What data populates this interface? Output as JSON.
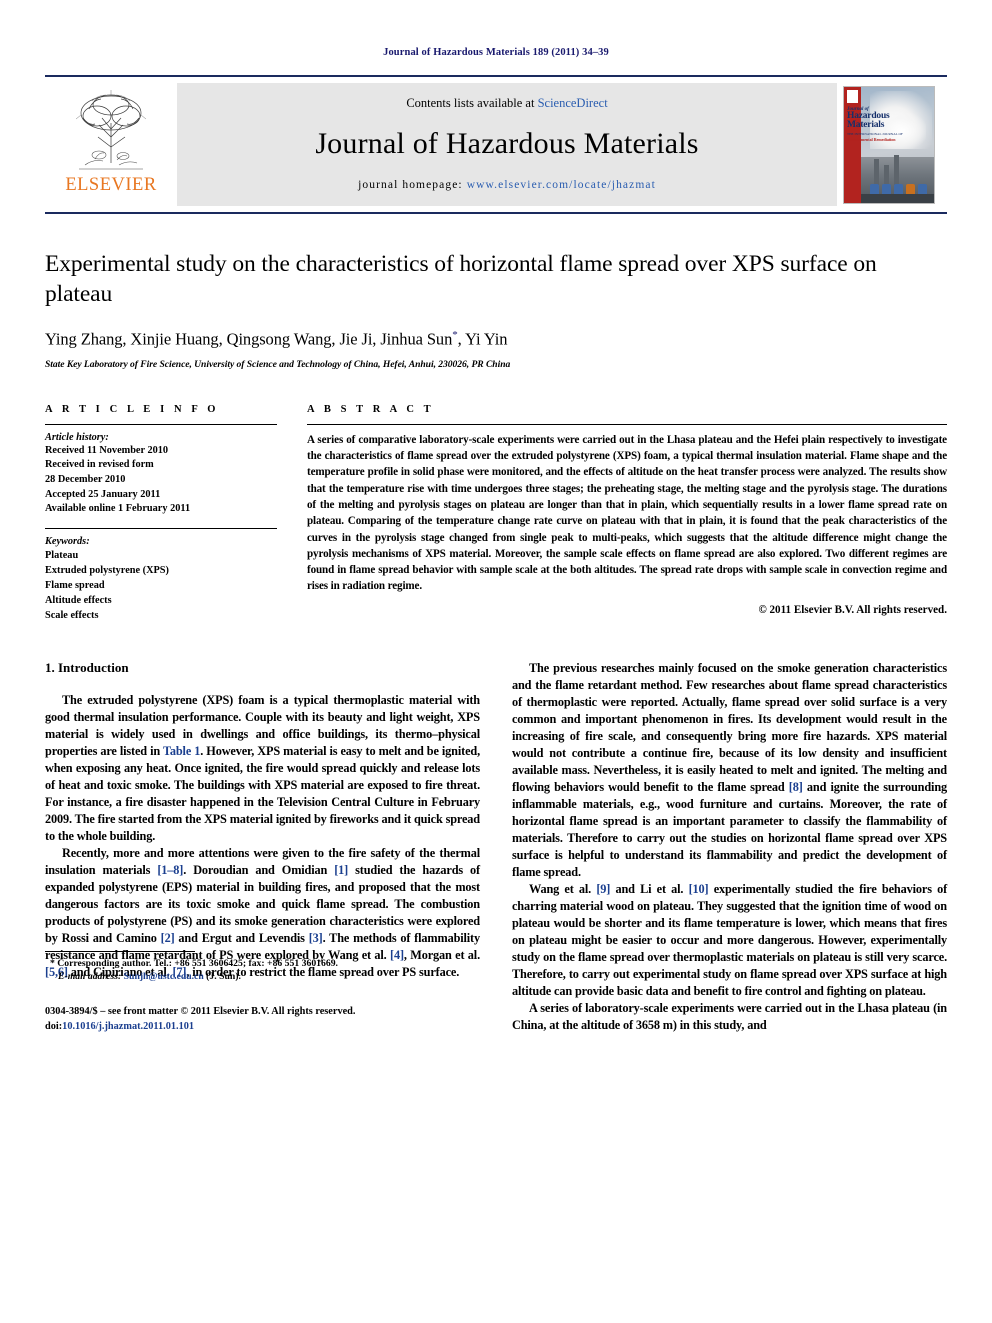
{
  "running_head": "Journal of Hazardous Materials 189 (2011) 34–39",
  "masthead": {
    "publisher": "ELSEVIER",
    "contents_prefix": "Contents lists available at ",
    "contents_link": "ScienceDirect",
    "journal_title": "Journal of Hazardous Materials",
    "homepage_prefix": "journal homepage:",
    "homepage_url": "www.elsevier.com/locate/jhazmat",
    "cover": {
      "line1": "Journal of",
      "line2": "Hazardous",
      "line3": "Materials",
      "line4": "THE INTERNATIONAL JOURNAL OF",
      "line5": "Environmental Remediation"
    }
  },
  "article": {
    "title": "Experimental study on the characteristics of horizontal flame spread over XPS surface on plateau",
    "authors": "Ying Zhang, Xinjie Huang, Qingsong Wang, Jie Ji, Jinhua Sun",
    "authors_suffix": ", Yi Yin",
    "corresponding_marker": "*",
    "affiliation": "State Key Laboratory of Fire Science, University of Science and Technology of China, Hefei, Anhui, 230026, PR China"
  },
  "article_info": {
    "heading": "A R T I C L E   I N F O",
    "history_label": "Article history:",
    "history": [
      "Received 11 November 2010",
      "Received in revised form",
      "28 December 2010",
      "Accepted 25 January 2011",
      "Available online 1 February 2011"
    ],
    "keywords_label": "Keywords:",
    "keywords": [
      "Plateau",
      "Extruded polystyrene (XPS)",
      "Flame spread",
      "Altitude effects",
      "Scale effects"
    ]
  },
  "abstract": {
    "heading": "A B S T R A C T",
    "text": "A series of comparative laboratory-scale experiments were carried out in the Lhasa plateau and the Hefei plain respectively to investigate the characteristics of flame spread over the extruded polystyrene (XPS) foam, a typical thermal insulation material. Flame shape and the temperature profile in solid phase were monitored, and the effects of altitude on the heat transfer process were analyzed. The results show that the temperature rise with time undergoes three stages; the preheating stage, the melting stage and the pyrolysis stage. The durations of the melting and pyrolysis stages on plateau are longer than that in plain, which sequentially results in a lower flame spread rate on plateau. Comparing of the temperature change rate curve on plateau with that in plain, it is found that the peak characteristics of the curves in the pyrolysis stage changed from single peak to multi-peaks, which suggests that the altitude difference might change the pyrolysis mechanisms of XPS material. Moreover, the sample scale effects on flame spread are also explored. Two different regimes are found in flame spread behavior with sample scale at the both altitudes. The spread rate drops with sample scale in convection regime and rises in radiation regime.",
    "copyright": "© 2011 Elsevier B.V. All rights reserved."
  },
  "body": {
    "section_heading": "1. Introduction",
    "left_p1_a": "The extruded polystyrene (XPS) foam is a typical thermoplastic material with good thermal insulation performance. Couple with its beauty and light weight, XPS material is widely used in dwellings and office buildings, its thermo–physical properties are listed in ",
    "left_p1_ref": "Table 1",
    "left_p1_b": ". However, XPS material is easy to melt and be ignited, when exposing any heat. Once ignited, the fire would spread quickly and release lots of heat and toxic smoke. The buildings with XPS material are exposed to fire threat. For instance, a fire disaster happened in the Television Central Culture in February 2009. The fire started from the XPS material ignited by fireworks and it quick spread to the whole building.",
    "left_p2_a": "Recently, more and more attentions were given to the fire safety of the thermal insulation materials ",
    "left_p2_r1": "[1–8]",
    "left_p2_b": ". Doroudian and Omidian ",
    "left_p2_r2": "[1]",
    "left_p2_c": " studied the hazards of expanded polystyrene (EPS) material in building fires, and proposed that the most dangerous factors are its toxic smoke and quick flame spread. The combustion products of polystyrene (PS) and its smoke generation characteristics were explored by Rossi and Camino ",
    "left_p2_r3": "[2]",
    "left_p2_d": " and Ergut and Levendis ",
    "left_p2_r4": "[3]",
    "left_p2_e": ". The methods of flammability resistance and flame retardant of PS were explored by Wang et al. ",
    "left_p2_r5": "[4]",
    "left_p2_f": ", Morgan et al. ",
    "left_p2_r6": "[5,6]",
    "left_p2_g": " and Cipiriano et al. ",
    "left_p2_r7": "[7]",
    "left_p2_h": ", in order to restrict the flame spread over PS surface.",
    "right_p1_a": "The previous researches mainly focused on the smoke generation characteristics and the flame retardant method. Few researches about flame spread characteristics of thermoplastic were reported. Actually, flame spread over solid surface is a very common and important phenomenon in fires. Its development would result in the increasing of fire scale, and consequently bring more fire hazards. XPS material would not contribute a continue fire, because of its low density and insufficient available mass. Nevertheless, it is easily heated to melt and ignited. The melting and flowing behaviors would benefit to the flame spread ",
    "right_p1_r1": "[8]",
    "right_p1_b": " and ignite the surrounding inflammable materials, e.g., wood furniture and curtains. Moreover, the rate of horizontal flame spread is an important parameter to classify the flammability of materials. Therefore to carry out the studies on horizontal flame spread over XPS surface is helpful to understand its flammability and predict the development of flame spread.",
    "right_p2_a": "Wang et al. ",
    "right_p2_r1": "[9]",
    "right_p2_b": " and Li et al. ",
    "right_p2_r2": "[10]",
    "right_p2_c": " experimentally studied the fire behaviors of charring material wood on plateau. They suggested that the ignition time of wood on plateau would be shorter and its flame temperature is lower, which means that fires on plateau might be easier to occur and more dangerous. However, experimentally study on the flame spread over thermoplastic materials on plateau is still very scarce. Therefore, to carry out experimental study on flame spread over XPS surface at high altitude can provide basic data and benefit to fire control and fighting on plateau.",
    "right_p3": "A series of laboratory-scale experiments were carried out in the Lhasa plateau (in China, at the altitude of 3658 m) in this study, and"
  },
  "footnotes": {
    "corresponding_a": "* Corresponding author. Tel.: +86 551 3606425; fax: +86 551 3601669.",
    "email_label": "E-mail address:",
    "email": "Sunjh@ustc.edu.cn",
    "email_suffix": " (J. Sun).",
    "issn_line": "0304-3894/$ – see front matter © 2011 Elsevier B.V. All rights reserved.",
    "doi_label": "doi:",
    "doi": "10.1016/j.jhazmat.2011.01.101"
  },
  "colors": {
    "link": "#2a5db0",
    "ref": "#1b3f8f",
    "elsevier_orange": "#E87722",
    "rule_navy": "#1a2a5e"
  }
}
